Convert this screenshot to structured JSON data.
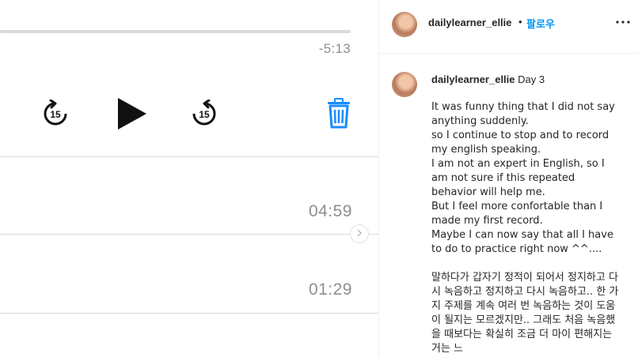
{
  "player": {
    "remaining_time": "-5:13",
    "icons": {
      "skip_back": "skip-back-15-icon",
      "play": "play-icon",
      "skip_forward": "skip-forward-15-icon",
      "delete": "trash-icon"
    },
    "skip_seconds": "15",
    "accent_color": "#1a8cff"
  },
  "recordings": [
    {
      "duration": "04:59"
    },
    {
      "duration": "01:29"
    }
  ],
  "post": {
    "author": "dailylearner_ellie",
    "separator": "•",
    "follow_label": "팔로우",
    "caption_title": "Day 3",
    "caption_body": "It was funny thing that I did not say anything suddenly.\nso I continue to stop and to record my english speaking.\nI am not an expert in English, so I am not sure if this repeated behavior will help me.\nBut I feel more confortable than I made my first record.\nMaybe I can now say that all I have to do to practice right now ^^....\n\n말하다가 갑자기 정적이 되어서 정지하고 다시 녹음하고 정지하고 다시 녹음하고.. 한 가지 주제를 계속 여러 번 녹음하는 것이 도움이 될지는 모르겠지만.. 그래도 처음 녹음했을 때보다는 확실히 조금 더 마이 편해지는 거는 느"
  }
}
